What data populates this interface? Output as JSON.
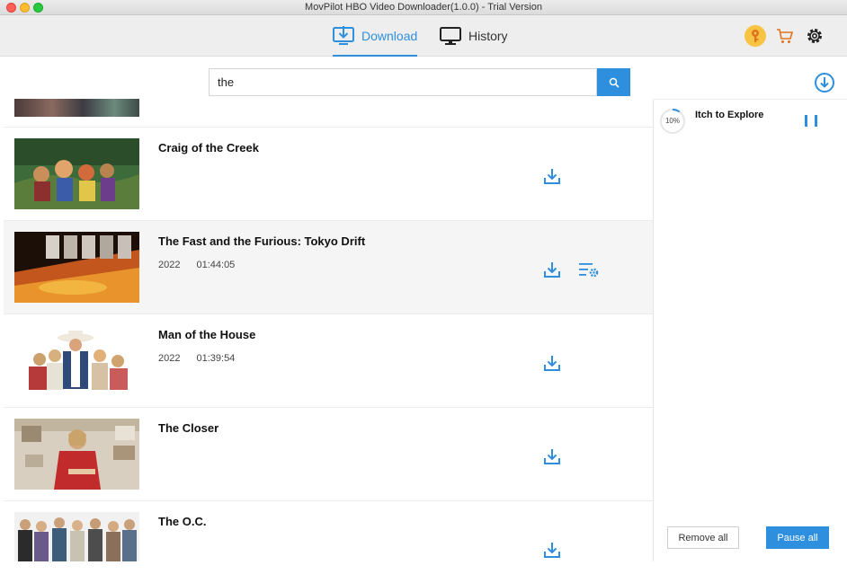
{
  "window": {
    "title": "MovPilot HBO Video Downloader(1.0.0) - Trial Version"
  },
  "toolbar": {
    "tabs": [
      {
        "label": "Download",
        "active": true
      },
      {
        "label": "History",
        "active": false
      }
    ],
    "icons": [
      "key-icon",
      "cart-icon",
      "gear-icon"
    ]
  },
  "search": {
    "value": "the",
    "placeholder": ""
  },
  "results": [
    {
      "title": "Craig of the Creek",
      "year": "",
      "duration": ""
    },
    {
      "title": "The Fast and the Furious: Tokyo Drift",
      "year": "2022",
      "duration": "01:44:05"
    },
    {
      "title": "Man of the House",
      "year": "2022",
      "duration": "01:39:54"
    },
    {
      "title": "The Closer",
      "year": "",
      "duration": ""
    },
    {
      "title": "The O.C.",
      "year": "",
      "duration": ""
    }
  ],
  "queue": {
    "tasks": [
      {
        "title": "Itch to Explore",
        "progress_label": "10%",
        "progress": 0.1
      }
    ],
    "remove_all_label": "Remove all",
    "pause_all_label": "Pause all"
  },
  "colors": {
    "accent": "#2f8fdf",
    "toolbar_bg": "#eeeeee",
    "key_badge": "#f6c343"
  }
}
